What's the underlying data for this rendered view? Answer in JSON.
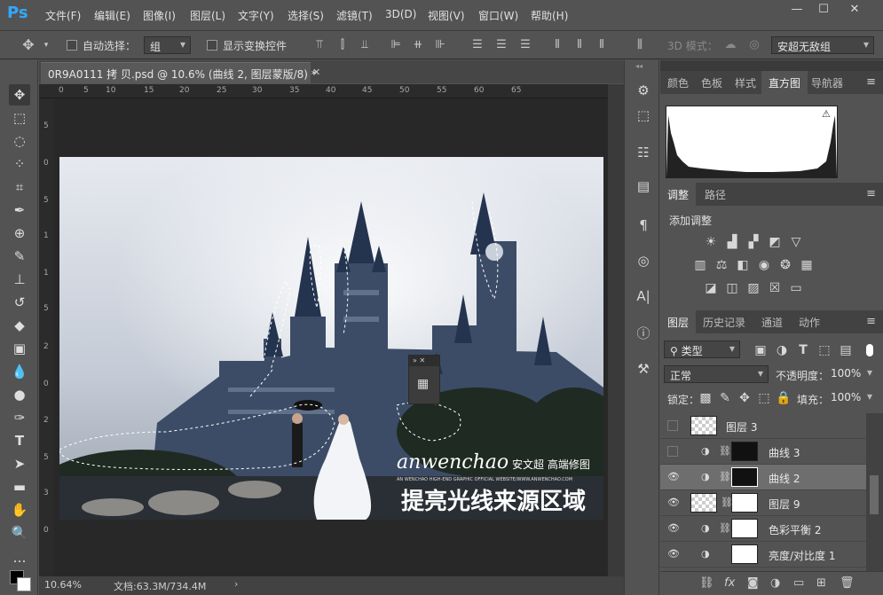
{
  "app": {
    "logo": "Ps"
  },
  "menu": [
    "文件(F)",
    "编辑(E)",
    "图像(I)",
    "图层(L)",
    "文字(Y)",
    "选择(S)",
    "滤镜(T)",
    "3D(D)",
    "视图(V)",
    "窗口(W)",
    "帮助(H)"
  ],
  "options": {
    "auto_select_label": "自动选择：",
    "auto_select_value": "组",
    "transform_label": "显示变换控件",
    "mode_label": "3D 模式：",
    "workspace": "安超无敌组"
  },
  "document": {
    "tab_title": "0R9A0111 拷 贝.psd @ 10.6% (曲线 2, 图层蒙版/8) *",
    "zoom": "10.64%",
    "doc_info": "文档:63.3M/734.4M",
    "ruler_h": [
      "0",
      "5",
      "10",
      "15",
      "20",
      "25",
      "30",
      "35",
      "40",
      "45",
      "50",
      "55",
      "60",
      "65"
    ],
    "ruler_v": [
      "5",
      "0",
      "5",
      "1",
      "1",
      "5",
      "2",
      "0",
      "2",
      "5",
      "3",
      "0"
    ]
  },
  "photo": {
    "brand": "anwenchao",
    "brand_cn": "安文超 高端修图",
    "brand_sub": "AN WENCHAO HIGH-END GRAPHIC OFFICIAL WEBSITE/WWW.ANWENCHAO.COM",
    "caption": "提亮光线来源区域"
  },
  "panels": {
    "top_tabs": [
      "颜色",
      "色板",
      "样式",
      "直方图",
      "导航器"
    ],
    "top_active": "直方图",
    "adj_tabs": [
      "调整",
      "路径"
    ],
    "adj_title": "添加调整",
    "layer_tabs": [
      "图层",
      "历史记录",
      "通道",
      "动作"
    ],
    "filter_type": "类型",
    "blend_mode": "正常",
    "opacity_label": "不透明度：",
    "opacity": "100%",
    "lock_label": "锁定：",
    "fill_label": "填充：",
    "fill": "100%"
  },
  "layers": [
    {
      "name": "图层 3",
      "visible": false,
      "kind": "pixel"
    },
    {
      "name": "曲线 3",
      "visible": false,
      "kind": "adjust"
    },
    {
      "name": "曲线 2",
      "visible": true,
      "kind": "adjust",
      "selected": true
    },
    {
      "name": "图层 9",
      "visible": true,
      "kind": "pixel"
    },
    {
      "name": "色彩平衡 2",
      "visible": true,
      "kind": "adjust"
    },
    {
      "name": "亮度/对比度 1",
      "visible": true,
      "kind": "adjust"
    }
  ],
  "colors": {
    "accent": "#31a8ff",
    "panel": "#535353",
    "selected": "#6e6e6e"
  }
}
